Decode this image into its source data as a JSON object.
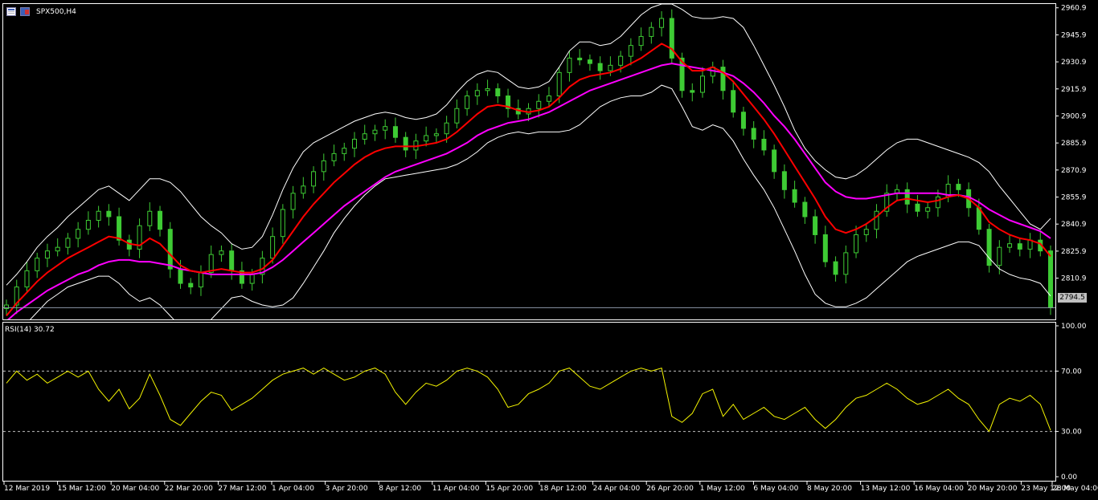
{
  "chart_header": {
    "symbol_timeframe": "SPX500,H4",
    "icons": [
      "chart-list-icon",
      "chart-props-icon"
    ]
  },
  "indicator_header": {
    "label": "RSI(14) 30.72"
  },
  "current_price_label": "2794.5",
  "colors": {
    "background": "#000000",
    "candles": "#3ecb34",
    "bollinger": "#ffffff",
    "ma_fast": "#ff0000",
    "ma_slow": "#ff00ff",
    "rsi": "#f4f400",
    "levels": "#c0c0c0"
  },
  "chart_data": [
    {
      "type": "line",
      "ylim": [
        2788,
        2963
      ],
      "y_ticks": [
        "2960.9",
        "2945.9",
        "2930.9",
        "2915.9",
        "2900.9",
        "2885.9",
        "2870.9",
        "2855.9",
        "2840.9",
        "2825.9",
        "2810.9"
      ],
      "x_ticks": [
        "12 Mar 2019",
        "15 Mar 12:00",
        "20 Mar 04:00",
        "22 Mar 20:00",
        "27 Mar 12:00",
        "1 Apr 04:00",
        "3 Apr 20:00",
        "8 Apr 12:00",
        "11 Apr 04:00",
        "15 Apr 20:00",
        "18 Apr 12:00",
        "24 Apr 04:00",
        "26 Apr 20:00",
        "1 May 12:00",
        "6 May 04:00",
        "8 May 20:00",
        "13 May 12:00",
        "16 May 04:00",
        "20 May 20:00",
        "23 May 12:00",
        "28 May 04:00"
      ],
      "series": [
        {
          "key": "close",
          "values": [
            2796,
            2806,
            2815,
            2822,
            2826,
            2828,
            2833,
            2838,
            2843,
            2848,
            2845,
            2832,
            2827,
            2840,
            2848,
            2838,
            2816,
            2808,
            2806,
            2814,
            2824,
            2826,
            2815,
            2808,
            2813,
            2822,
            2834,
            2849,
            2858,
            2862,
            2870,
            2876,
            2880,
            2883,
            2888,
            2891,
            2893,
            2895,
            2889,
            2882,
            2887,
            2890,
            2891,
            2897,
            2905,
            2912,
            2915,
            2916,
            2912,
            2905,
            2902,
            2905,
            2909,
            2912,
            2925,
            2933,
            2932,
            2930,
            2926,
            2929,
            2934,
            2940,
            2945,
            2950,
            2955,
            2933,
            2915,
            2914,
            2923,
            2928,
            2915,
            2903,
            2894,
            2888,
            2882,
            2870,
            2860,
            2853,
            2845,
            2835,
            2820,
            2813,
            2825,
            2835,
            2838,
            2848,
            2858,
            2860,
            2852,
            2848,
            2850,
            2856,
            2863,
            2860,
            2850,
            2838,
            2818,
            2828,
            2830,
            2827,
            2832,
            2826,
            2794.5
          ]
        },
        {
          "key": "ma_fast",
          "values": [
            2790,
            2797,
            2803,
            2809,
            2814,
            2818,
            2822,
            2825,
            2828,
            2831,
            2834,
            2833,
            2830,
            2829,
            2833,
            2830,
            2824,
            2818,
            2815,
            2814,
            2815,
            2816,
            2815,
            2814,
            2814,
            2816,
            2821,
            2829,
            2837,
            2845,
            2852,
            2858,
            2864,
            2869,
            2874,
            2878,
            2881,
            2883,
            2884,
            2884,
            2884,
            2885,
            2886,
            2888,
            2892,
            2897,
            2902,
            2906,
            2907,
            2906,
            2904,
            2903,
            2904,
            2906,
            2911,
            2917,
            2921,
            2923,
            2924,
            2925,
            2927,
            2930,
            2933,
            2937,
            2941,
            2938,
            2931,
            2926,
            2926,
            2928,
            2925,
            2920,
            2913,
            2906,
            2899,
            2891,
            2882,
            2873,
            2864,
            2855,
            2845,
            2838,
            2836,
            2838,
            2841,
            2845,
            2850,
            2854,
            2855,
            2854,
            2853,
            2854,
            2856,
            2857,
            2855,
            2850,
            2842,
            2838,
            2835,
            2833,
            2832,
            2830,
            2823
          ]
        },
        {
          "key": "ma_slow",
          "values": [
            2787,
            2792,
            2796,
            2800,
            2804,
            2807,
            2810,
            2813,
            2815,
            2818,
            2820,
            2821,
            2821,
            2820,
            2820,
            2819,
            2818,
            2816,
            2815,
            2814,
            2813,
            2813,
            2813,
            2813,
            2813,
            2814,
            2817,
            2821,
            2826,
            2831,
            2836,
            2841,
            2846,
            2851,
            2855,
            2859,
            2863,
            2867,
            2870,
            2872,
            2874,
            2876,
            2878,
            2880,
            2883,
            2886,
            2890,
            2893,
            2895,
            2897,
            2898,
            2899,
            2901,
            2903,
            2906,
            2909,
            2912,
            2915,
            2917,
            2919,
            2921,
            2923,
            2925,
            2927,
            2929,
            2930,
            2929,
            2928,
            2927,
            2926,
            2925,
            2923,
            2919,
            2914,
            2908,
            2901,
            2895,
            2888,
            2880,
            2872,
            2864,
            2859,
            2856,
            2855,
            2855,
            2856,
            2857,
            2858,
            2858,
            2858,
            2858,
            2858,
            2857,
            2857,
            2856,
            2853,
            2849,
            2846,
            2843,
            2841,
            2839,
            2837,
            2833
          ]
        },
        {
          "key": "bb_upper",
          "values": [
            2807,
            2813,
            2820,
            2828,
            2834,
            2839,
            2845,
            2850,
            2855,
            2860,
            2862,
            2858,
            2854,
            2860,
            2866,
            2866,
            2864,
            2859,
            2852,
            2845,
            2840,
            2836,
            2830,
            2827,
            2828,
            2834,
            2846,
            2860,
            2872,
            2881,
            2886,
            2889,
            2892,
            2895,
            2898,
            2900,
            2902,
            2903,
            2902,
            2900,
            2899,
            2900,
            2902,
            2907,
            2914,
            2920,
            2924,
            2926,
            2925,
            2921,
            2917,
            2916,
            2917,
            2920,
            2928,
            2937,
            2942,
            2942,
            2940,
            2941,
            2945,
            2951,
            2957,
            2961,
            2963,
            2963,
            2960,
            2956,
            2955,
            2955,
            2956,
            2955,
            2950,
            2940,
            2929,
            2918,
            2906,
            2893,
            2883,
            2876,
            2871,
            2867,
            2866,
            2868,
            2872,
            2877,
            2882,
            2886,
            2888,
            2888,
            2886,
            2884,
            2882,
            2880,
            2878,
            2875,
            2870,
            2862,
            2855,
            2848,
            2841,
            2838,
            2844
          ]
        },
        {
          "key": "bb_lower",
          "values": [
            2770,
            2778,
            2786,
            2792,
            2798,
            2802,
            2806,
            2808,
            2810,
            2812,
            2812,
            2808,
            2802,
            2798,
            2800,
            2796,
            2790,
            2784,
            2782,
            2783,
            2788,
            2794,
            2800,
            2801,
            2798,
            2796,
            2795,
            2796,
            2800,
            2808,
            2817,
            2826,
            2836,
            2844,
            2851,
            2857,
            2862,
            2866,
            2867,
            2868,
            2869,
            2870,
            2871,
            2872,
            2874,
            2877,
            2881,
            2886,
            2889,
            2891,
            2892,
            2891,
            2892,
            2892,
            2892,
            2893,
            2896,
            2901,
            2906,
            2909,
            2911,
            2912,
            2912,
            2914,
            2918,
            2916,
            2906,
            2895,
            2893,
            2896,
            2894,
            2887,
            2877,
            2868,
            2860,
            2850,
            2838,
            2826,
            2813,
            2802,
            2797,
            2795,
            2795,
            2797,
            2800,
            2805,
            2810,
            2815,
            2820,
            2823,
            2825,
            2827,
            2829,
            2831,
            2831,
            2829,
            2822,
            2816,
            2813,
            2811,
            2810,
            2808,
            2801
          ]
        }
      ]
    },
    {
      "type": "line",
      "title": "RSI(14) 30.72",
      "ylim": [
        0,
        100
      ],
      "y_ticks": [
        "100.00",
        "70.00",
        "30.00",
        "0.00"
      ],
      "levels": [
        70,
        30
      ],
      "series": [
        {
          "key": "rsi",
          "values": [
            62,
            70,
            64,
            68,
            62,
            66,
            70,
            66,
            70,
            58,
            50,
            58,
            45,
            52,
            68,
            54,
            38,
            34,
            42,
            50,
            56,
            54,
            44,
            48,
            52,
            58,
            64,
            68,
            70,
            72,
            68,
            72,
            68,
            64,
            66,
            70,
            72,
            68,
            56,
            48,
            56,
            62,
            60,
            64,
            70,
            72,
            70,
            66,
            58,
            46,
            48,
            55,
            58,
            62,
            70,
            72,
            66,
            60,
            58,
            62,
            66,
            70,
            72,
            70,
            72,
            40,
            36,
            42,
            55,
            58,
            40,
            48,
            38,
            42,
            46,
            40,
            38,
            42,
            46,
            38,
            32,
            38,
            46,
            52,
            54,
            58,
            62,
            58,
            52,
            48,
            50,
            54,
            58,
            52,
            48,
            38,
            30,
            48,
            52,
            50,
            54,
            48,
            30.72
          ]
        }
      ]
    }
  ]
}
